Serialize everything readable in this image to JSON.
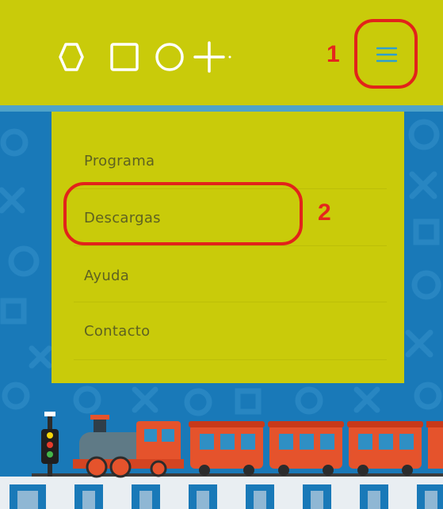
{
  "header": {
    "logo_shapes": [
      "hexagon",
      "square",
      "circle",
      "plus"
    ],
    "menu_icon": "hamburger-icon"
  },
  "callouts": {
    "one": "1",
    "two": "2"
  },
  "menu": {
    "items": [
      {
        "label": "Programa"
      },
      {
        "label": "Descargas"
      },
      {
        "label": "Ayuda"
      },
      {
        "label": "Contacto"
      }
    ]
  },
  "colors": {
    "header_bg": "#c9cb0a",
    "background": "#1979b8",
    "menu_text": "#5e6221",
    "annotation_red": "#e2231a",
    "menu_icon": "#2e9fcf"
  }
}
